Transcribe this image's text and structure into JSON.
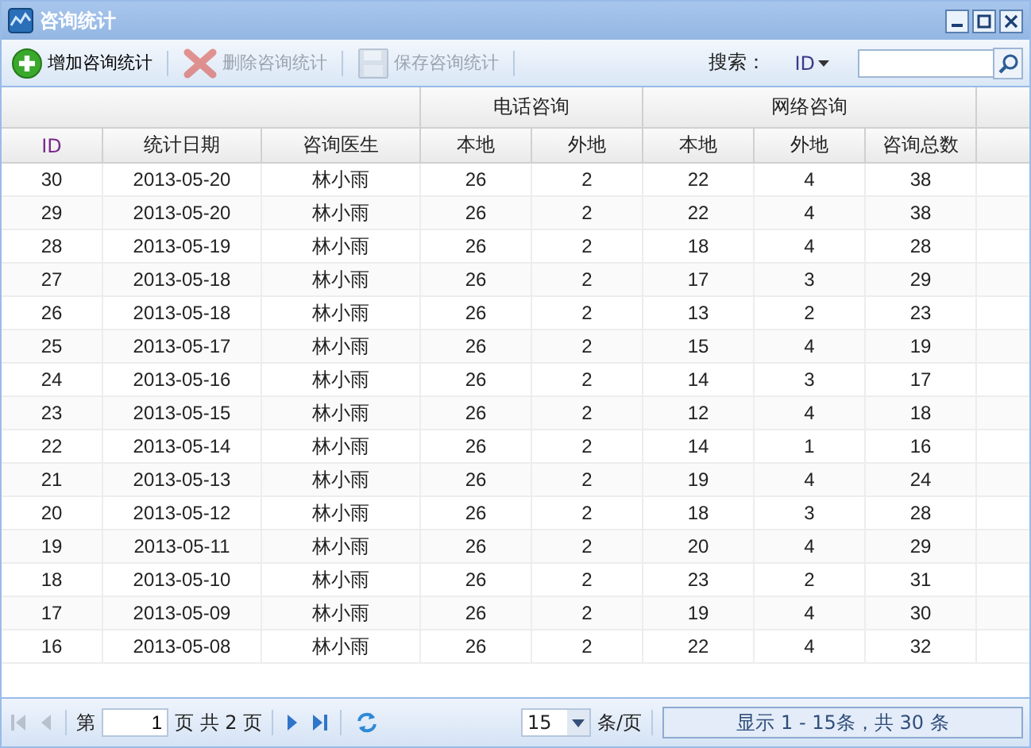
{
  "window": {
    "title": "咨询统计"
  },
  "toolbar": [
    {
      "label": "增加咨询统计",
      "kind": "add",
      "disabled": false
    },
    {
      "label": "删除咨询统计",
      "kind": "delete",
      "disabled": true
    },
    {
      "label": "保存咨询统计",
      "kind": "save",
      "disabled": true
    }
  ],
  "search": {
    "label": "搜索：",
    "field": "ID"
  },
  "table": {
    "groups": [
      {
        "label": "电话咨询"
      },
      {
        "label": "网络咨询"
      }
    ],
    "columns": [
      "ID",
      "统计日期",
      "咨询医生",
      "本地",
      "外地",
      "本地",
      "外地",
      "咨询总数"
    ],
    "rows": [
      [
        "30",
        "2013-05-20",
        "林小雨",
        "26",
        "2",
        "22",
        "4",
        "38"
      ],
      [
        "29",
        "2013-05-20",
        "林小雨",
        "26",
        "2",
        "22",
        "4",
        "38"
      ],
      [
        "28",
        "2013-05-19",
        "林小雨",
        "26",
        "2",
        "18",
        "4",
        "28"
      ],
      [
        "27",
        "2013-05-18",
        "林小雨",
        "26",
        "2",
        "17",
        "3",
        "29"
      ],
      [
        "26",
        "2013-05-18",
        "林小雨",
        "26",
        "2",
        "13",
        "2",
        "23"
      ],
      [
        "25",
        "2013-05-17",
        "林小雨",
        "26",
        "2",
        "15",
        "4",
        "19"
      ],
      [
        "24",
        "2013-05-16",
        "林小雨",
        "26",
        "2",
        "14",
        "3",
        "17"
      ],
      [
        "23",
        "2013-05-15",
        "林小雨",
        "26",
        "2",
        "12",
        "4",
        "18"
      ],
      [
        "22",
        "2013-05-14",
        "林小雨",
        "26",
        "2",
        "14",
        "1",
        "16"
      ],
      [
        "21",
        "2013-05-13",
        "林小雨",
        "26",
        "2",
        "19",
        "4",
        "24"
      ],
      [
        "20",
        "2013-05-12",
        "林小雨",
        "26",
        "2",
        "18",
        "3",
        "28"
      ],
      [
        "19",
        "2013-05-11",
        "林小雨",
        "26",
        "2",
        "20",
        "4",
        "29"
      ],
      [
        "18",
        "2013-05-10",
        "林小雨",
        "26",
        "2",
        "23",
        "2",
        "31"
      ],
      [
        "17",
        "2013-05-09",
        "林小雨",
        "26",
        "2",
        "19",
        "4",
        "30"
      ],
      [
        "16",
        "2013-05-08",
        "林小雨",
        "26",
        "2",
        "22",
        "4",
        "32"
      ]
    ]
  },
  "pager": {
    "page_prefix": "第",
    "page": "1",
    "page_suffix": "页 共 2 页",
    "page_size": "15",
    "per_page": "条/页",
    "summary": "显示 1 - 15条，共 30 条"
  }
}
